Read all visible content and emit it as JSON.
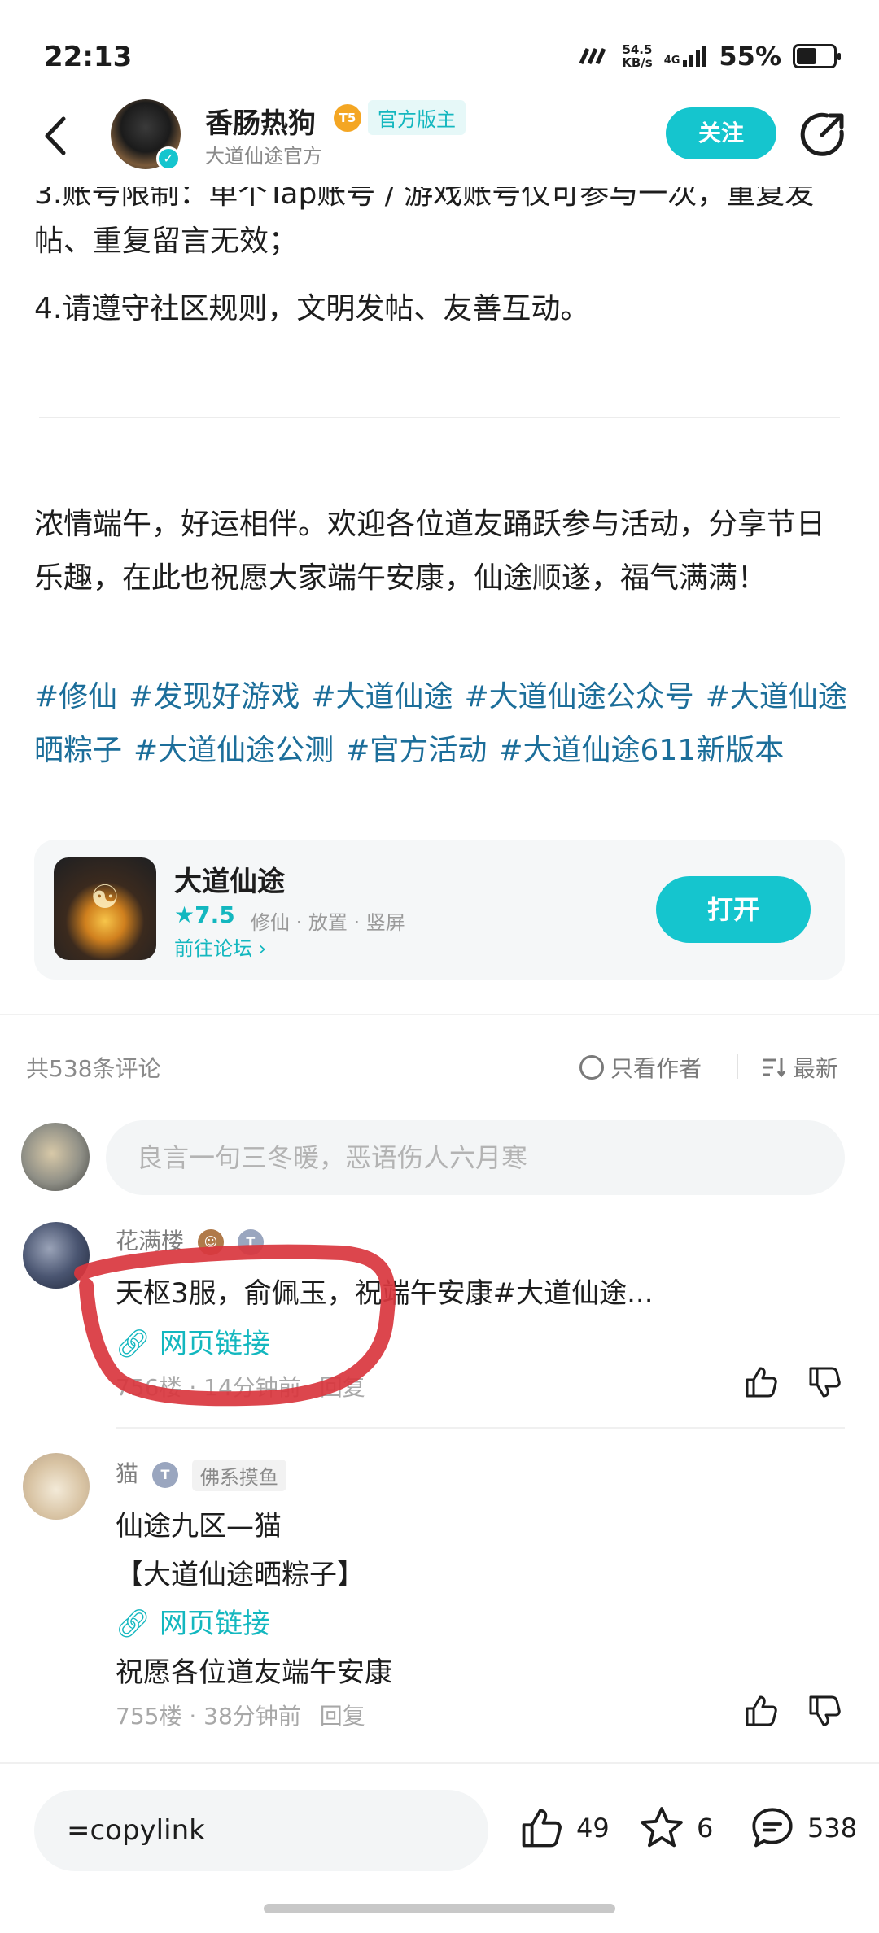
{
  "status_bar": {
    "time": "22:13",
    "speed_value": "54.5",
    "speed_unit": "KB/s",
    "network": "4G",
    "battery": "55%",
    "battery_level": 0.55
  },
  "header": {
    "author_name": "香肠热狗",
    "level_badge": "5",
    "role_badge": "官方版主",
    "author_sub": "大道仙途官方",
    "follow_label": "关注"
  },
  "post": {
    "rule3_partial": "3.账号限制：单个Tap账号 / 游戏账号仅可参与一次，重复发帖、重复留言无效；",
    "rule4": "4.请遵守社区规则，文明发帖、友善互动。",
    "greeting": "浓情端午，好运相伴。欢迎各位道友踊跃参与活动，分享节日乐趣，在此也祝愿大家端午安康，仙途顺遂，福气满满！",
    "tags": [
      "#修仙",
      "#发现好游戏",
      "#大道仙途",
      "#大道仙途公众号",
      "#大道仙途晒粽子",
      "#大道仙途公测",
      "#官方活动",
      "#大道仙途611新版本"
    ]
  },
  "app_card": {
    "name": "大道仙途",
    "rating": "7.5",
    "genres": "修仙 · 放置 · 竖屏",
    "forum_link": "前往论坛",
    "open_label": "打开"
  },
  "comments_section": {
    "count": "共538条评论",
    "only_author": "只看作者",
    "sort": "最新",
    "input_placeholder": "良言一句三冬暖，恶语伤人六月寒"
  },
  "comments": [
    {
      "user": "花满楼",
      "text": "天枢3服，俞佩玉，祝端午安康#大道仙途...",
      "link": "网页链接",
      "meta": "756楼 · 14分钟前",
      "reply": "回复"
    },
    {
      "user": "猫",
      "user_tag": "佛系摸鱼",
      "line1": "仙途九区—猫",
      "line2": "【大道仙途晒粽子】",
      "link": "网页链接",
      "line3": "祝愿各位道友端午安康",
      "meta": "755楼 · 38分钟前",
      "reply": "回复"
    }
  ],
  "bottom_bar": {
    "input_text": "=copylink",
    "likes": "49",
    "stars": "6",
    "comments": "538"
  },
  "colors": {
    "accent": "#15c5ce",
    "tag_blue": "#1c6e9a",
    "annotation_red": "#d9363e"
  }
}
